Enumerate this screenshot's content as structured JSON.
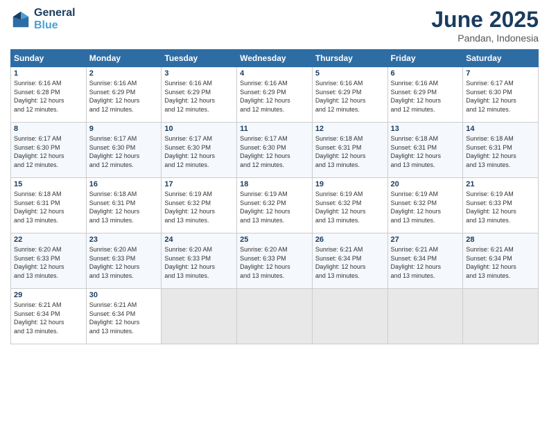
{
  "header": {
    "logo_line1": "General",
    "logo_line2": "Blue",
    "month": "June 2025",
    "location": "Pandan, Indonesia"
  },
  "days_of_week": [
    "Sunday",
    "Monday",
    "Tuesday",
    "Wednesday",
    "Thursday",
    "Friday",
    "Saturday"
  ],
  "weeks": [
    [
      {
        "day": "1",
        "info": "Sunrise: 6:16 AM\nSunset: 6:28 PM\nDaylight: 12 hours\nand 12 minutes."
      },
      {
        "day": "2",
        "info": "Sunrise: 6:16 AM\nSunset: 6:29 PM\nDaylight: 12 hours\nand 12 minutes."
      },
      {
        "day": "3",
        "info": "Sunrise: 6:16 AM\nSunset: 6:29 PM\nDaylight: 12 hours\nand 12 minutes."
      },
      {
        "day": "4",
        "info": "Sunrise: 6:16 AM\nSunset: 6:29 PM\nDaylight: 12 hours\nand 12 minutes."
      },
      {
        "day": "5",
        "info": "Sunrise: 6:16 AM\nSunset: 6:29 PM\nDaylight: 12 hours\nand 12 minutes."
      },
      {
        "day": "6",
        "info": "Sunrise: 6:16 AM\nSunset: 6:29 PM\nDaylight: 12 hours\nand 12 minutes."
      },
      {
        "day": "7",
        "info": "Sunrise: 6:17 AM\nSunset: 6:30 PM\nDaylight: 12 hours\nand 12 minutes."
      }
    ],
    [
      {
        "day": "8",
        "info": "Sunrise: 6:17 AM\nSunset: 6:30 PM\nDaylight: 12 hours\nand 12 minutes."
      },
      {
        "day": "9",
        "info": "Sunrise: 6:17 AM\nSunset: 6:30 PM\nDaylight: 12 hours\nand 12 minutes."
      },
      {
        "day": "10",
        "info": "Sunrise: 6:17 AM\nSunset: 6:30 PM\nDaylight: 12 hours\nand 12 minutes."
      },
      {
        "day": "11",
        "info": "Sunrise: 6:17 AM\nSunset: 6:30 PM\nDaylight: 12 hours\nand 12 minutes."
      },
      {
        "day": "12",
        "info": "Sunrise: 6:18 AM\nSunset: 6:31 PM\nDaylight: 12 hours\nand 13 minutes."
      },
      {
        "day": "13",
        "info": "Sunrise: 6:18 AM\nSunset: 6:31 PM\nDaylight: 12 hours\nand 13 minutes."
      },
      {
        "day": "14",
        "info": "Sunrise: 6:18 AM\nSunset: 6:31 PM\nDaylight: 12 hours\nand 13 minutes."
      }
    ],
    [
      {
        "day": "15",
        "info": "Sunrise: 6:18 AM\nSunset: 6:31 PM\nDaylight: 12 hours\nand 13 minutes."
      },
      {
        "day": "16",
        "info": "Sunrise: 6:18 AM\nSunset: 6:31 PM\nDaylight: 12 hours\nand 13 minutes."
      },
      {
        "day": "17",
        "info": "Sunrise: 6:19 AM\nSunset: 6:32 PM\nDaylight: 12 hours\nand 13 minutes."
      },
      {
        "day": "18",
        "info": "Sunrise: 6:19 AM\nSunset: 6:32 PM\nDaylight: 12 hours\nand 13 minutes."
      },
      {
        "day": "19",
        "info": "Sunrise: 6:19 AM\nSunset: 6:32 PM\nDaylight: 12 hours\nand 13 minutes."
      },
      {
        "day": "20",
        "info": "Sunrise: 6:19 AM\nSunset: 6:32 PM\nDaylight: 12 hours\nand 13 minutes."
      },
      {
        "day": "21",
        "info": "Sunrise: 6:19 AM\nSunset: 6:33 PM\nDaylight: 12 hours\nand 13 minutes."
      }
    ],
    [
      {
        "day": "22",
        "info": "Sunrise: 6:20 AM\nSunset: 6:33 PM\nDaylight: 12 hours\nand 13 minutes."
      },
      {
        "day": "23",
        "info": "Sunrise: 6:20 AM\nSunset: 6:33 PM\nDaylight: 12 hours\nand 13 minutes."
      },
      {
        "day": "24",
        "info": "Sunrise: 6:20 AM\nSunset: 6:33 PM\nDaylight: 12 hours\nand 13 minutes."
      },
      {
        "day": "25",
        "info": "Sunrise: 6:20 AM\nSunset: 6:33 PM\nDaylight: 12 hours\nand 13 minutes."
      },
      {
        "day": "26",
        "info": "Sunrise: 6:21 AM\nSunset: 6:34 PM\nDaylight: 12 hours\nand 13 minutes."
      },
      {
        "day": "27",
        "info": "Sunrise: 6:21 AM\nSunset: 6:34 PM\nDaylight: 12 hours\nand 13 minutes."
      },
      {
        "day": "28",
        "info": "Sunrise: 6:21 AM\nSunset: 6:34 PM\nDaylight: 12 hours\nand 13 minutes."
      }
    ],
    [
      {
        "day": "29",
        "info": "Sunrise: 6:21 AM\nSunset: 6:34 PM\nDaylight: 12 hours\nand 13 minutes."
      },
      {
        "day": "30",
        "info": "Sunrise: 6:21 AM\nSunset: 6:34 PM\nDaylight: 12 hours\nand 13 minutes."
      },
      {
        "day": "",
        "info": ""
      },
      {
        "day": "",
        "info": ""
      },
      {
        "day": "",
        "info": ""
      },
      {
        "day": "",
        "info": ""
      },
      {
        "day": "",
        "info": ""
      }
    ]
  ]
}
